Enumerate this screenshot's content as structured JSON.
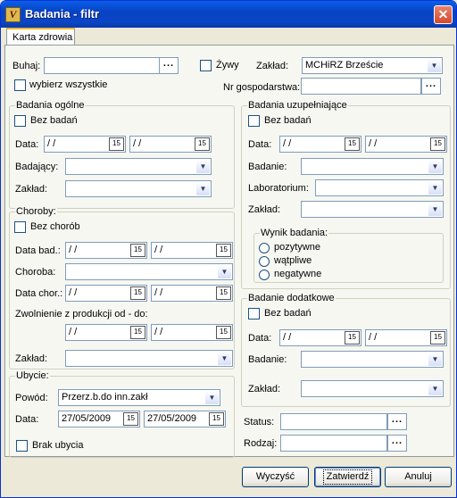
{
  "window": {
    "title": "Badania - filtr",
    "close_icon": "close-icon",
    "app_icon": "app-logo-icon"
  },
  "tabs": [
    {
      "label": "Karta zdrowia"
    }
  ],
  "top": {
    "buhaj_label": "Buhaj:",
    "buhaj_value": "",
    "dots": "...",
    "wybierz_label": "wybierz wszystkie",
    "zywy_label": "Żywy",
    "zaklad_label": "Zakład:",
    "zaklad_value": "MCHiRZ Brzeście",
    "nr_gosp_label": "Nr gospodarstwa:",
    "nr_gosp_value": ""
  },
  "ogolne": {
    "title": "Badania ogólne",
    "bez_label": "Bez badań",
    "data_label": "Data:",
    "date_from": " / /",
    "date_to": " / /",
    "badajacy_label": "Badający:",
    "zaklad_label": "Zakład:"
  },
  "choroby": {
    "title": "Choroby:",
    "bez_label": "Bez chorób",
    "data_bad_label": "Data bad.:",
    "date_bad_from": " / /",
    "date_bad_to": " / /",
    "choroba_label": "Choroba:",
    "data_chor_label": "Data chor.:",
    "date_chor_from": " / /",
    "date_chor_to": " / /",
    "zwolnienie_label": "Zwolnienie z produkcji od - do:",
    "zw_from": " / /",
    "zw_to": " / /",
    "zaklad_label": "Zakład:"
  },
  "ubycie": {
    "title": "Ubycie:",
    "powod_label": "Powód:",
    "powod_value": "Przerz.b.do inn.zakł",
    "data_label": "Data:",
    "date_from": "27/05/2009",
    "date_to": "27/05/2009",
    "brak_label": "Brak ubycia"
  },
  "uzup": {
    "title": "Badania uzupełniające",
    "bez_label": "Bez badań",
    "data_label": "Data:",
    "date_from": " / /",
    "date_to": " / /",
    "badanie_label": "Badanie:",
    "laboratorium_label": "Laboratorium:",
    "zaklad_label": "Zakład:",
    "wynik_title": "Wynik badania:",
    "wynik_options": [
      "pozytywne",
      "wątpliwe",
      "negatywne"
    ]
  },
  "dodatkowe": {
    "title": "Badanie dodatkowe",
    "bez_label": "Bez badań",
    "data_label": "Data:",
    "date_from": " / /",
    "date_to": " / /",
    "badanie_label": "Badanie:",
    "zaklad_label": "Zakład:"
  },
  "bottom": {
    "status_label": "Status:",
    "rodzaj_label": "Rodzaj:",
    "dots": "..."
  },
  "calendar_glyph": "15",
  "buttons": {
    "clear": "Wyczyść",
    "confirm": "Zatwierdź",
    "cancel": "Anuluj"
  }
}
